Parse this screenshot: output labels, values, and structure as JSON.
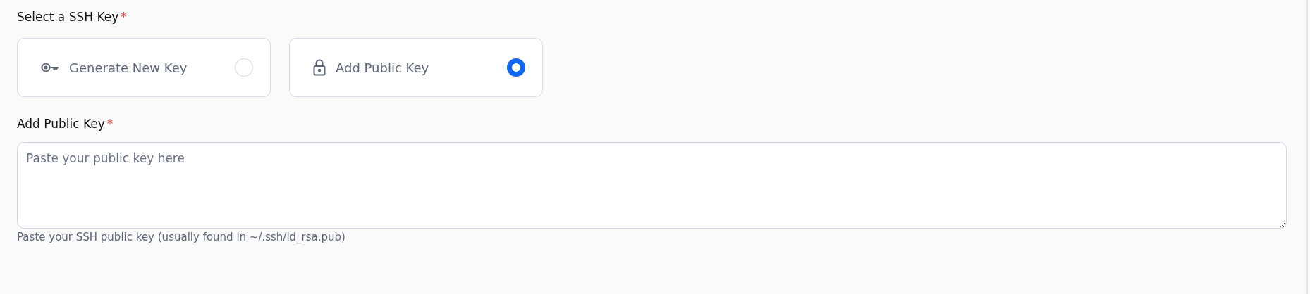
{
  "key_select": {
    "label": "Select a SSH Key",
    "required_mark": "*",
    "options": [
      {
        "kind": "generate",
        "label": "Generate New Key",
        "selected": false
      },
      {
        "kind": "public",
        "label": "Add Public Key",
        "selected": true
      }
    ]
  },
  "public_key": {
    "label": "Add Public Key",
    "required_mark": "*",
    "placeholder": "Paste your public key here",
    "help": "Paste your SSH public key (usually found in ~/.ssh/id_rsa.pub)"
  }
}
